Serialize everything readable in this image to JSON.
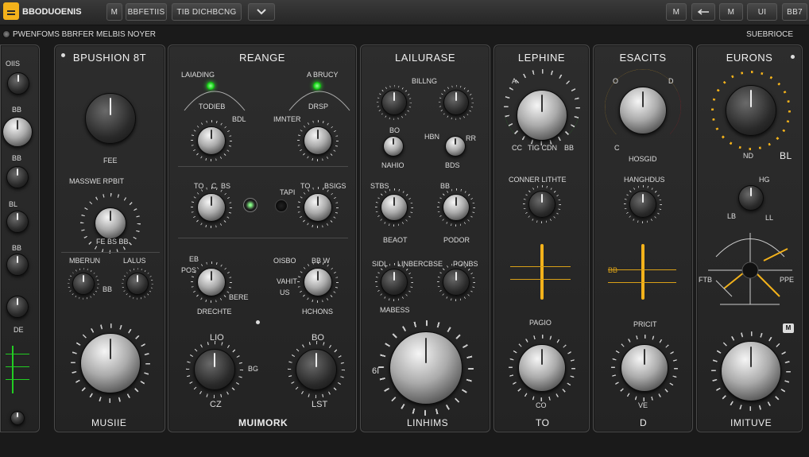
{
  "topbar": {
    "preset_name": "BBODUOENIS",
    "btn_left": "M",
    "tab1": "BBFETIIS",
    "tab2": "TIB DICHBCNG",
    "btn_right1": "M",
    "btn_right3": "M",
    "btn_right4": "UI",
    "btn_right5": "BB7"
  },
  "subbar": {
    "left": "PWENFOMS BBRFER MELBIS NOYER",
    "right": "SUEBRIOCE"
  },
  "strip": {
    "label1": "OIIS",
    "label2": "BB",
    "label3": "BB",
    "label4": "BL",
    "label5": "BB",
    "label6": "DE"
  },
  "panel1": {
    "title": "BPUSHION 8T",
    "fe": "FEE",
    "mid_label": "MASSWE RPBIT",
    "sub": "FE BS BB",
    "l1": "MBERUN",
    "l2": "LALUS",
    "l3": "BB",
    "bottom": "MUSIIE"
  },
  "panel2": {
    "title": "REANGE",
    "tl": "LAIADING",
    "tr": "A BRUCY",
    "l_todier": "TODIEB",
    "l_bdl": "BDL",
    "l_drsp": "DRSP",
    "l_imnter": "IMNTER",
    "to": "TO",
    "cc": "C",
    "bs": "BS",
    "to2": "TO",
    "bsgs": "BSIGS",
    "tapi": "TAPI",
    "pos": "POS",
    "eb": "EB",
    "oisbo": "OISBO",
    "bbw": "BB W",
    "varit": "VAHIT",
    "us": "US",
    "bere": "BERE",
    "drechte": "DRECHTE",
    "hchons": "HCHONS",
    "lio": "LIO",
    "bo": "BO",
    "bg": "BG",
    "cz": "CZ",
    "lst": "LST",
    "bottom": "MUIMORK"
  },
  "panel3": {
    "title": "LAILURASE",
    "top": "BILLNG",
    "bo": "BO",
    "hbn": "HBN",
    "rr": "RR",
    "nahio": "NAHIO",
    "bds": "BDS",
    "stbs": "STBS",
    "bb": "BB",
    "beaot": "BEAOT",
    "podor": "PODOR",
    "sidl": "SIDL",
    "line": "LINBERCBSE",
    "ponbs": "PONBS",
    "mabess": "MABESS",
    "sixty": "6I",
    "bottom": "LINHIMS"
  },
  "panel4": {
    "title": "LEPHINE",
    "a": "A",
    "tig": "TIG CDN",
    "bb": "BB",
    "cc": "CC",
    "conner": "CONNER LITHTE",
    "pagio": "PAGIO",
    "bottom": "TO",
    "co": "CO"
  },
  "panel5": {
    "title": "ESACITS",
    "o": "O",
    "d": "D",
    "c": "C",
    "hosgd": "HOSGID",
    "hang": "HANGHDUS",
    "pricit": "PRICIT",
    "bb": "BB",
    "ve": "VE",
    "bottom": "D"
  },
  "panel6": {
    "title": "EURONS",
    "nd": "ND",
    "bl": "BL",
    "hg": "HG",
    "lb": "LB",
    "ll": "LL",
    "ftb": "FTB",
    "ppe": "PPE",
    "ms": "M",
    "bottom": "IMITUVE"
  }
}
